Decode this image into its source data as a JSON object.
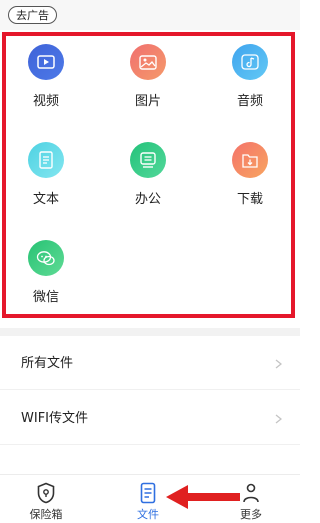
{
  "top_bar": {
    "ad_button_label": "去广告"
  },
  "categories": [
    {
      "label": "视频",
      "icon": "video-icon",
      "color_from": "#3f63d8",
      "color_to": "#4d79e8"
    },
    {
      "label": "图片",
      "icon": "image-icon",
      "color_from": "#f06f6f",
      "color_to": "#f59a6a"
    },
    {
      "label": "音频",
      "icon": "music-icon",
      "color_from": "#3fa4ee",
      "color_to": "#63c9f5"
    },
    {
      "label": "文本",
      "icon": "document-icon",
      "color_from": "#4ed2e2",
      "color_to": "#83e6f0"
    },
    {
      "label": "办公",
      "icon": "office-icon",
      "color_from": "#23c27a",
      "color_to": "#53d89a"
    },
    {
      "label": "下载",
      "icon": "download-icon",
      "color_from": "#f4726a",
      "color_to": "#f8a560"
    },
    {
      "label": "微信",
      "icon": "wechat-icon",
      "color_from": "#27c274",
      "color_to": "#5fdb95"
    }
  ],
  "list": [
    {
      "label": "所有文件"
    },
    {
      "label": "WIFI传文件"
    }
  ],
  "bottom_nav": [
    {
      "label": "保险箱",
      "icon": "vault-icon",
      "active": false
    },
    {
      "label": "文件",
      "icon": "file-icon",
      "active": true
    },
    {
      "label": "更多",
      "icon": "more-icon",
      "active": false
    }
  ],
  "colors": {
    "highlight": "#e5172b",
    "active_tab": "#2f6fe0",
    "annotation_arrow": "#e02020"
  }
}
